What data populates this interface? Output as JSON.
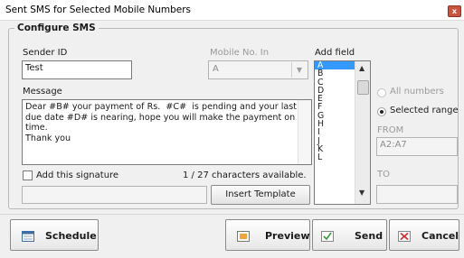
{
  "window": {
    "title": "Sent SMS for Selected Mobile Numbers",
    "close_glyph": "x"
  },
  "configure": {
    "legend": "Configure SMS",
    "sender_id_label": "Sender ID",
    "sender_id_value": "Test",
    "mobile_label": "Mobile No. In",
    "mobile_value": "A",
    "add_field_label": "Add field",
    "add_field_items": [
      "A",
      "B",
      "C",
      "D",
      "E",
      "F",
      "G",
      "H",
      "I",
      "J",
      "K",
      "L"
    ],
    "add_field_selected": "A",
    "message_label": "Message",
    "message_value": "Dear #B# your payment of Rs.  #C#  is pending and your last due date #D# is nearing, hope you will make the payment on time.\nThank you",
    "signature_label": "Add this signature",
    "signature_value": "",
    "char_count": "1 / 27 characters available.",
    "insert_template_label": "Insert Template",
    "all_numbers_label": "All numbers",
    "selected_range_label": "Selected range",
    "from_label": "FROM",
    "from_value": "A2:A7",
    "to_label": "TO",
    "to_value": ""
  },
  "buttons": {
    "schedule": "Schedule",
    "preview": "Preview",
    "send": "Send",
    "cancel": "Cancel"
  }
}
